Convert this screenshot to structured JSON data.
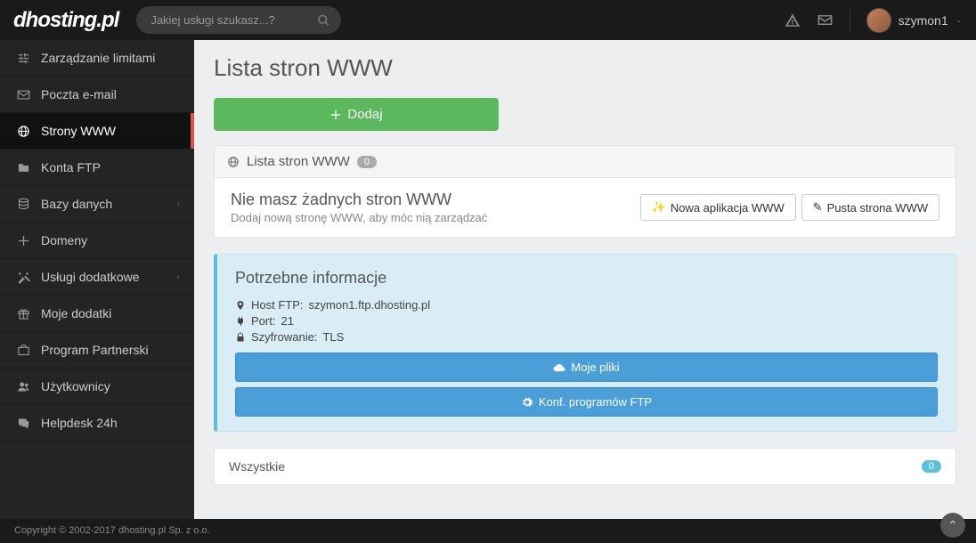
{
  "header": {
    "logo": "dhosting.pl",
    "search_placeholder": "Jakiej usługi szukasz...?",
    "username": "szymon1"
  },
  "sidebar": {
    "items": [
      {
        "label": "Zarządzanie limitami",
        "icon": "sliders",
        "expandable": false
      },
      {
        "label": "Poczta e-mail",
        "icon": "envelope",
        "expandable": false
      },
      {
        "label": "Strony WWW",
        "icon": "globe",
        "expandable": false,
        "active": true
      },
      {
        "label": "Konta FTP",
        "icon": "folder",
        "expandable": false
      },
      {
        "label": "Bazy danych",
        "icon": "database",
        "expandable": true
      },
      {
        "label": "Domeny",
        "icon": "plus-square",
        "expandable": false
      },
      {
        "label": "Usługi dodatkowe",
        "icon": "tools",
        "expandable": true
      },
      {
        "label": "Moje dodatki",
        "icon": "gift",
        "expandable": false
      },
      {
        "label": "Program Partnerski",
        "icon": "briefcase",
        "expandable": false
      },
      {
        "label": "Użytkownicy",
        "icon": "users",
        "expandable": false
      },
      {
        "label": "Helpdesk 24h",
        "icon": "chat",
        "expandable": false
      }
    ]
  },
  "page": {
    "title": "Lista stron WWW",
    "add_label": "Dodaj",
    "panel_title": "Lista stron WWW",
    "panel_count": "0",
    "empty_title": "Nie masz żadnych stron WWW",
    "empty_sub": "Dodaj nową stronę WWW, aby móc nią zarządzać",
    "btn_new_app": "Nowa aplikacja WWW",
    "btn_empty_page": "Pusta strona WWW"
  },
  "info": {
    "title": "Potrzebne informacje",
    "host_label": "Host FTP:",
    "host_value": "szymon1.ftp.dhosting.pl",
    "port_label": "Port:",
    "port_value": "21",
    "enc_label": "Szyfrowanie:",
    "enc_value": "TLS",
    "btn_files": "Moje pliki",
    "btn_ftp_config": "Konf. programów FTP"
  },
  "filter": {
    "label": "Wszystkie",
    "count": "0"
  },
  "footer": {
    "copyright": "Copyright © 2002-2017 dhosting.pl Sp. z o.o."
  }
}
